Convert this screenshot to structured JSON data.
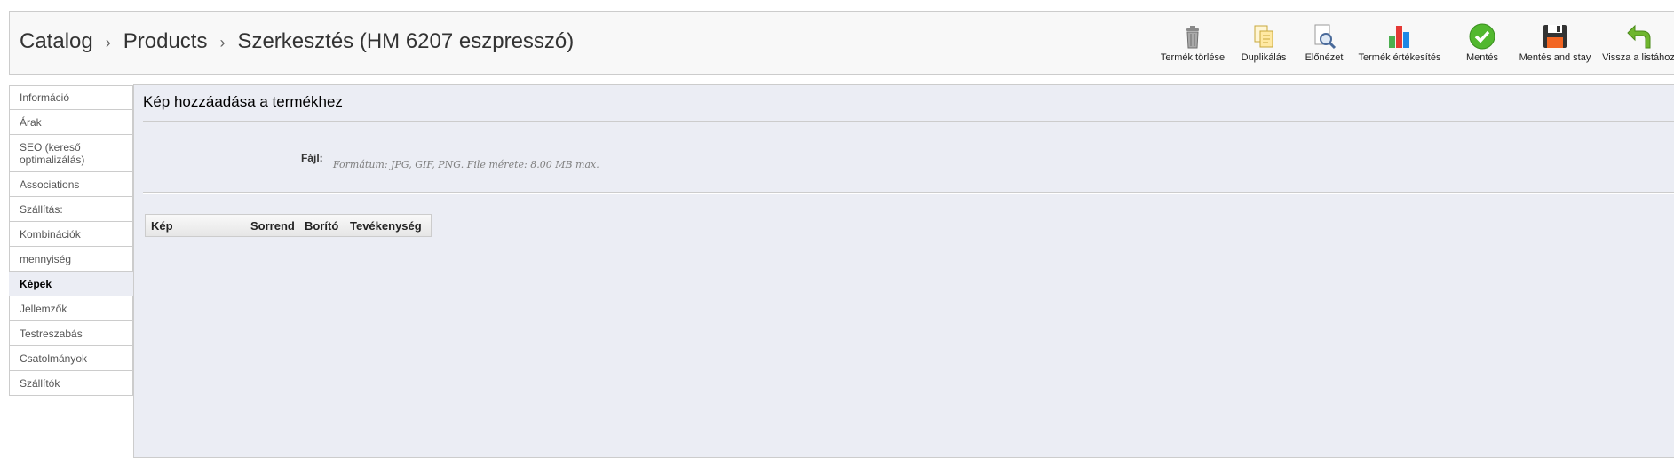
{
  "breadcrumb": {
    "items": [
      "Catalog",
      "Products",
      "Szerkesztés (HM 6207 eszpresszó)"
    ],
    "separator": "›"
  },
  "toolbar": {
    "buttons": [
      {
        "label": "Termék törlése",
        "icon": "trash-icon"
      },
      {
        "label": "Duplikálás",
        "icon": "duplicate-icon"
      },
      {
        "label": "Előnézet",
        "icon": "preview-icon"
      },
      {
        "label": "Termék értékesítés",
        "icon": "bar-chart-icon"
      },
      {
        "label": "Mentés",
        "icon": "check-circle-icon"
      },
      {
        "label": "Mentés and stay",
        "icon": "floppy-disk-icon"
      },
      {
        "label": "Vissza a listához",
        "icon": "back-arrow-icon"
      }
    ]
  },
  "tabs": {
    "items": [
      {
        "label": "Információ"
      },
      {
        "label": "Árak"
      },
      {
        "label": "SEO (kereső optimalizálás)"
      },
      {
        "label": "Associations"
      },
      {
        "label": "Szállítás:"
      },
      {
        "label": "Kombinációk"
      },
      {
        "label": "mennyiség"
      },
      {
        "label": "Képek",
        "active": true
      },
      {
        "label": "Jellemzők"
      },
      {
        "label": "Testreszabás"
      },
      {
        "label": "Csatolmányok"
      },
      {
        "label": "Szállítók"
      }
    ]
  },
  "content": {
    "title": "Kép hozzáadása a termékhez",
    "file_label": "Fájl:",
    "file_hint": "Formátum: JPG, GIF, PNG. File mérete: 8.00 MB max.",
    "table_headers": [
      "Kép",
      "Sorrend",
      "Borító",
      "Tevékenység"
    ]
  },
  "colors": {
    "panel_bg": "#ebedf4",
    "toolbar_bg": "#f8f8f8",
    "border": "#cccccc"
  }
}
